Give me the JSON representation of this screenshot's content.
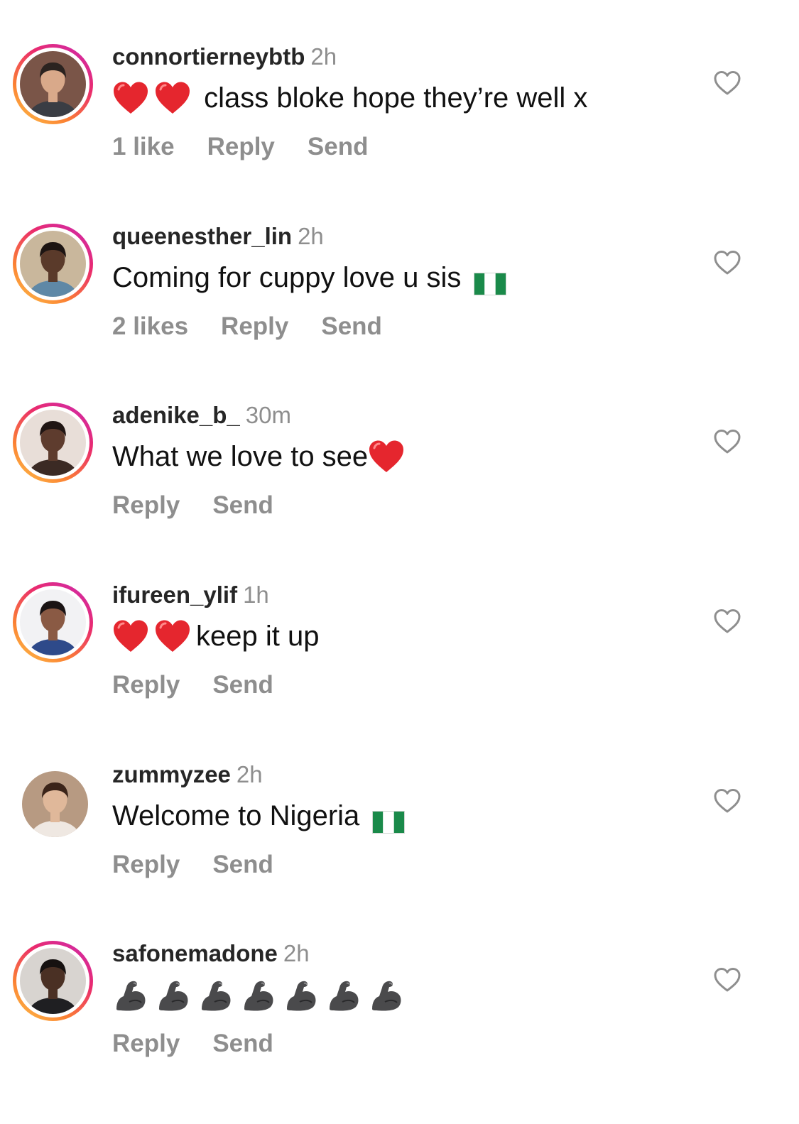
{
  "comments": [
    {
      "username": "connortierneybtb",
      "time": "2h",
      "story_ring": true,
      "avatar_colors": {
        "bg": "#7a5548",
        "face": "#d9a98a",
        "hair": "#2b2320",
        "shirt": "#3a3d44"
      },
      "text_parts": [
        {
          "kind": "emoji",
          "icon": "red-heart-emoji"
        },
        {
          "kind": "emoji",
          "icon": "red-heart-emoji"
        },
        {
          "kind": "text",
          "value": " class bloke hope they’re well x"
        }
      ],
      "likes": "1 like",
      "reply": "Reply",
      "send": "Send"
    },
    {
      "username": "queenesther_lin",
      "time": "2h",
      "story_ring": true,
      "avatar_colors": {
        "bg": "#c9b79c",
        "face": "#5a3a2a",
        "hair": "#1c1412",
        "shirt": "#5f88a6"
      },
      "text_parts": [
        {
          "kind": "text",
          "value": "Coming for cuppy love u sis"
        },
        {
          "kind": "emoji",
          "icon": "nigeria-flag-emoji"
        }
      ],
      "likes": "2 likes",
      "reply": "Reply",
      "send": "Send"
    },
    {
      "username": "adenike_b_",
      "time": "30m",
      "story_ring": true,
      "avatar_colors": {
        "bg": "#e8ded8",
        "face": "#5e3c2e",
        "hair": "#201513",
        "shirt": "#3b2a24"
      },
      "text_parts": [
        {
          "kind": "text",
          "value": "What we love to see"
        },
        {
          "kind": "emoji",
          "icon": "red-heart-emoji"
        }
      ],
      "likes": "",
      "reply": "Reply",
      "send": "Send"
    },
    {
      "username": "ifureen_ylif",
      "time": "1h",
      "story_ring": true,
      "avatar_colors": {
        "bg": "#f2f2f4",
        "face": "#8a5a44",
        "hair": "#1a1414",
        "shirt": "#2e4a8a"
      },
      "text_parts": [
        {
          "kind": "emoji",
          "icon": "red-heart-emoji"
        },
        {
          "kind": "emoji",
          "icon": "red-heart-emoji"
        },
        {
          "kind": "text",
          "value": "keep it up"
        }
      ],
      "likes": "",
      "reply": "Reply",
      "send": "Send"
    },
    {
      "username": "zummyzee",
      "time": "2h",
      "story_ring": false,
      "avatar_colors": {
        "bg": "#b79a82",
        "face": "#e0b89a",
        "hair": "#3b2419",
        "shirt": "#efe8e2"
      },
      "text_parts": [
        {
          "kind": "text",
          "value": "Welcome to Nigeria"
        },
        {
          "kind": "emoji",
          "icon": "nigeria-flag-emoji"
        }
      ],
      "likes": "",
      "reply": "Reply",
      "send": "Send"
    },
    {
      "username": "safonemadone",
      "time": "2h",
      "story_ring": true,
      "avatar_colors": {
        "bg": "#d8d4d0",
        "face": "#4a3024",
        "hair": "#161110",
        "shirt": "#1f1f22"
      },
      "text_parts": [
        {
          "kind": "emoji",
          "icon": "flexed-biceps-emoji"
        },
        {
          "kind": "emoji",
          "icon": "flexed-biceps-emoji"
        },
        {
          "kind": "emoji",
          "icon": "flexed-biceps-emoji"
        },
        {
          "kind": "emoji",
          "icon": "flexed-biceps-emoji"
        },
        {
          "kind": "emoji",
          "icon": "flexed-biceps-emoji"
        },
        {
          "kind": "emoji",
          "icon": "flexed-biceps-emoji"
        },
        {
          "kind": "emoji",
          "icon": "flexed-biceps-emoji"
        }
      ],
      "likes": "",
      "reply": "Reply",
      "send": "Send"
    }
  ],
  "like_icon": "heart-outline-icon",
  "colors": {
    "secondary_text": "#8e8e8e",
    "primary_text": "#262626",
    "heart_red": "#e5262e",
    "flag_green": "#1a8a4a"
  }
}
